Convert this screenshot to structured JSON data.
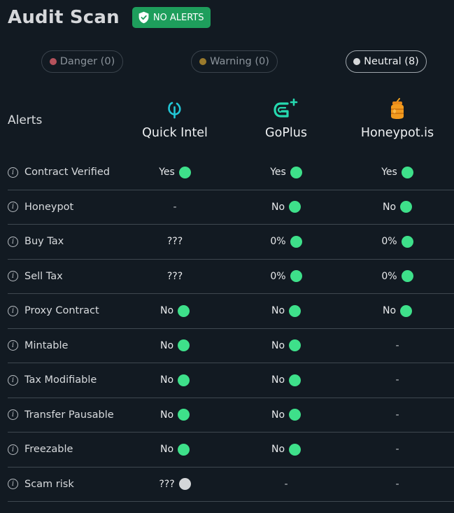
{
  "header": {
    "title": "Audit Scan",
    "badge": "NO ALERTS"
  },
  "filters": [
    {
      "label": "Danger (0)",
      "dot": "#b5525c",
      "active": false
    },
    {
      "label": "Warning (0)",
      "dot": "#9a7a2c",
      "active": false
    },
    {
      "label": "Neutral (8)",
      "dot": "#d6d8da",
      "active": true
    }
  ],
  "table": {
    "alerts_label": "Alerts",
    "providers": [
      "Quick Intel",
      "GoPlus",
      "Honeypot.is"
    ],
    "rows": [
      {
        "label": "Contract Verified",
        "cells": [
          {
            "text": "Yes",
            "status": "ok"
          },
          {
            "text": "Yes",
            "status": "ok"
          },
          {
            "text": "Yes",
            "status": "ok"
          }
        ]
      },
      {
        "label": "Honeypot",
        "cells": [
          {
            "text": "-",
            "status": ""
          },
          {
            "text": "No",
            "status": "ok"
          },
          {
            "text": "No",
            "status": "ok"
          }
        ]
      },
      {
        "label": "Buy Tax",
        "cells": [
          {
            "text": "???",
            "status": ""
          },
          {
            "text": "0%",
            "status": "ok"
          },
          {
            "text": "0%",
            "status": "ok"
          }
        ]
      },
      {
        "label": "Sell Tax",
        "cells": [
          {
            "text": "???",
            "status": ""
          },
          {
            "text": "0%",
            "status": "ok"
          },
          {
            "text": "0%",
            "status": "ok"
          }
        ]
      },
      {
        "label": "Proxy Contract",
        "cells": [
          {
            "text": "No",
            "status": "ok"
          },
          {
            "text": "No",
            "status": "ok"
          },
          {
            "text": "No",
            "status": "ok"
          }
        ]
      },
      {
        "label": "Mintable",
        "cells": [
          {
            "text": "No",
            "status": "ok"
          },
          {
            "text": "No",
            "status": "ok"
          },
          {
            "text": "-",
            "status": ""
          }
        ]
      },
      {
        "label": "Tax Modifiable",
        "cells": [
          {
            "text": "No",
            "status": "ok"
          },
          {
            "text": "No",
            "status": "ok"
          },
          {
            "text": "-",
            "status": ""
          }
        ]
      },
      {
        "label": "Transfer Pausable",
        "cells": [
          {
            "text": "No",
            "status": "ok"
          },
          {
            "text": "No",
            "status": "ok"
          },
          {
            "text": "-",
            "status": ""
          }
        ]
      },
      {
        "label": "Freezable",
        "cells": [
          {
            "text": "No",
            "status": "ok"
          },
          {
            "text": "No",
            "status": "ok"
          },
          {
            "text": "-",
            "status": ""
          }
        ]
      },
      {
        "label": "Scam risk",
        "cells": [
          {
            "text": "???",
            "status": "neutral"
          },
          {
            "text": "-",
            "status": ""
          },
          {
            "text": "-",
            "status": ""
          }
        ]
      }
    ]
  },
  "colors": {
    "ok": "#3ee08a",
    "neutral": "#d4d6d8",
    "badge": "#1e9e5c",
    "background": "#121a22"
  }
}
